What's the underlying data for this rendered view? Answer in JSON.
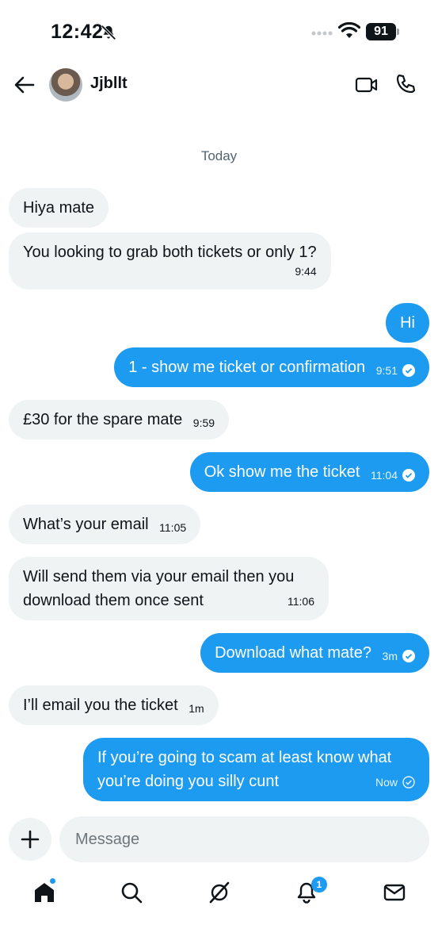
{
  "status_bar": {
    "time": "12:42",
    "battery": "91"
  },
  "header": {
    "name": "Jjbllt"
  },
  "conversation": {
    "day_label": "Today",
    "messages": [
      {
        "dir": "in",
        "text": "Hiya mate",
        "time": ""
      },
      {
        "dir": "in",
        "text": "You looking to grab both tickets or only 1?",
        "time": "9:44"
      },
      {
        "dir": "out",
        "text": "Hi",
        "time": ""
      },
      {
        "dir": "out",
        "text": "1 - show me ticket or confirmation",
        "time": "9:51"
      },
      {
        "dir": "in",
        "text": "£30 for the spare mate",
        "time": "9:59"
      },
      {
        "dir": "out",
        "text": "Ok show me the ticket",
        "time": "11:04"
      },
      {
        "dir": "in",
        "text": "What’s your email",
        "time": "11:05"
      },
      {
        "dir": "in",
        "text_line1": "Will send them via your email then you",
        "text_line2": "download them once sent",
        "time": "11:06"
      },
      {
        "dir": "out",
        "text": "Download what mate?",
        "time": "3m"
      },
      {
        "dir": "in",
        "text": "I’ll email you the ticket",
        "time": "1m"
      },
      {
        "dir": "out",
        "text_line1": "If you’re going to scam at least know what",
        "text_line2": "you’re doing you silly cunt",
        "time": "Now"
      }
    ]
  },
  "composer": {
    "placeholder": "Message"
  },
  "tabbar": {
    "notification_count": "1"
  },
  "colors": {
    "accent": "#1d9bf0",
    "bubble_in": "#eff3f4",
    "text": "#0f1419",
    "muted": "#536471"
  }
}
